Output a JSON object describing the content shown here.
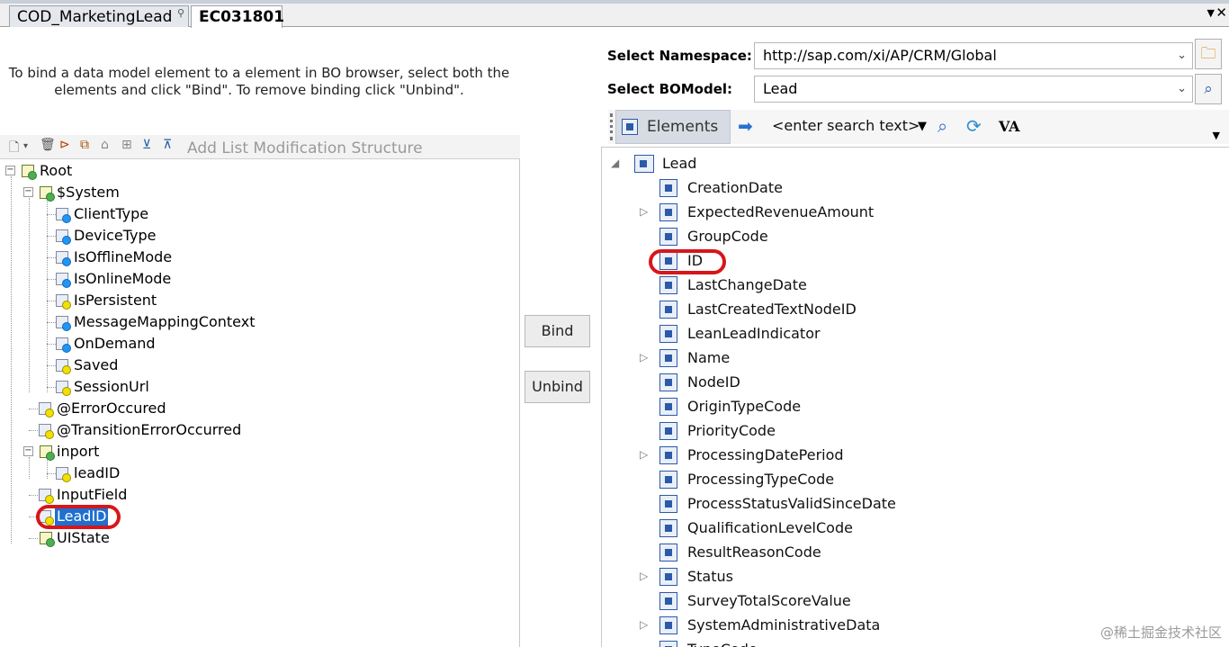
{
  "tabs": [
    {
      "label": "COD_MarketingLead",
      "active": false
    },
    {
      "label": "EC031801",
      "active": true
    }
  ],
  "instruction": "To bind a data model element to a element in BO browser, select both the elements and click \"Bind\". To remove binding click \"Unbind\".",
  "left_toolbar": {
    "add_list_modification": "Add List Modification Structure"
  },
  "left_tree": [
    {
      "label": "Root",
      "icon": "struct-icon"
    },
    {
      "label": "$System",
      "icon": "struct-icon"
    },
    {
      "label": "ClientType",
      "icon": "blue-element-icon"
    },
    {
      "label": "DeviceType",
      "icon": "blue-element-icon"
    },
    {
      "label": "IsOfflineMode",
      "icon": "blue-element-icon"
    },
    {
      "label": "IsOnlineMode",
      "icon": "blue-element-icon"
    },
    {
      "label": "IsPersistent",
      "icon": "yellow-element-icon"
    },
    {
      "label": "MessageMappingContext",
      "icon": "blue-element-icon"
    },
    {
      "label": "OnDemand",
      "icon": "blue-element-icon"
    },
    {
      "label": "Saved",
      "icon": "yellow-element-icon"
    },
    {
      "label": "SessionUrl",
      "icon": "yellow-element-icon"
    },
    {
      "label": "@ErrorOccured",
      "icon": "yellow-element-icon"
    },
    {
      "label": "@TransitionErrorOccurred",
      "icon": "yellow-element-icon"
    },
    {
      "label": "inport",
      "icon": "struct-icon"
    },
    {
      "label": "leadID",
      "icon": "yellow-element-icon"
    },
    {
      "label": "InputField",
      "icon": "yellow-element-icon"
    },
    {
      "label": "LeadID",
      "icon": "yellow-element-icon",
      "selected": true
    },
    {
      "label": "UIState",
      "icon": "struct-icon"
    }
  ],
  "buttons": {
    "bind": "Bind",
    "unbind": "Unbind"
  },
  "namespace": {
    "label": "Select Namespace:",
    "value": "http://sap.com/xi/AP/CRM/Global"
  },
  "bomodel": {
    "label": "Select BOModel:",
    "value": "Lead"
  },
  "right_toolbar": {
    "elements_label": "Elements",
    "search_placeholder": "<enter search text>",
    "va_label": "VA"
  },
  "right_tree": {
    "root": "Lead",
    "items": [
      {
        "label": "CreationDate",
        "expandable": false
      },
      {
        "label": "ExpectedRevenueAmount",
        "expandable": true
      },
      {
        "label": "GroupCode",
        "expandable": false
      },
      {
        "label": "ID",
        "expandable": false,
        "highlighted": true
      },
      {
        "label": "LastChangeDate",
        "expandable": false
      },
      {
        "label": "LastCreatedTextNodeID",
        "expandable": false
      },
      {
        "label": "LeanLeadIndicator",
        "expandable": false
      },
      {
        "label": "Name",
        "expandable": true
      },
      {
        "label": "NodeID",
        "expandable": false
      },
      {
        "label": "OriginTypeCode",
        "expandable": false
      },
      {
        "label": "PriorityCode",
        "expandable": false
      },
      {
        "label": "ProcessingDatePeriod",
        "expandable": true
      },
      {
        "label": "ProcessingTypeCode",
        "expandable": false
      },
      {
        "label": "ProcessStatusValidSinceDate",
        "expandable": false
      },
      {
        "label": "QualificationLevelCode",
        "expandable": false
      },
      {
        "label": "ResultReasonCode",
        "expandable": false
      },
      {
        "label": "Status",
        "expandable": true
      },
      {
        "label": "SurveyTotalScoreValue",
        "expandable": false
      },
      {
        "label": "SystemAdministrativeData",
        "expandable": true
      },
      {
        "label": "TypeCode",
        "expandable": false
      }
    ]
  },
  "watermark": "@稀土掘金技术社区",
  "colors": {
    "selection": "#1e6fd0",
    "highlight_oval": "#d7161b",
    "element_icon": "#2b5aa8"
  }
}
